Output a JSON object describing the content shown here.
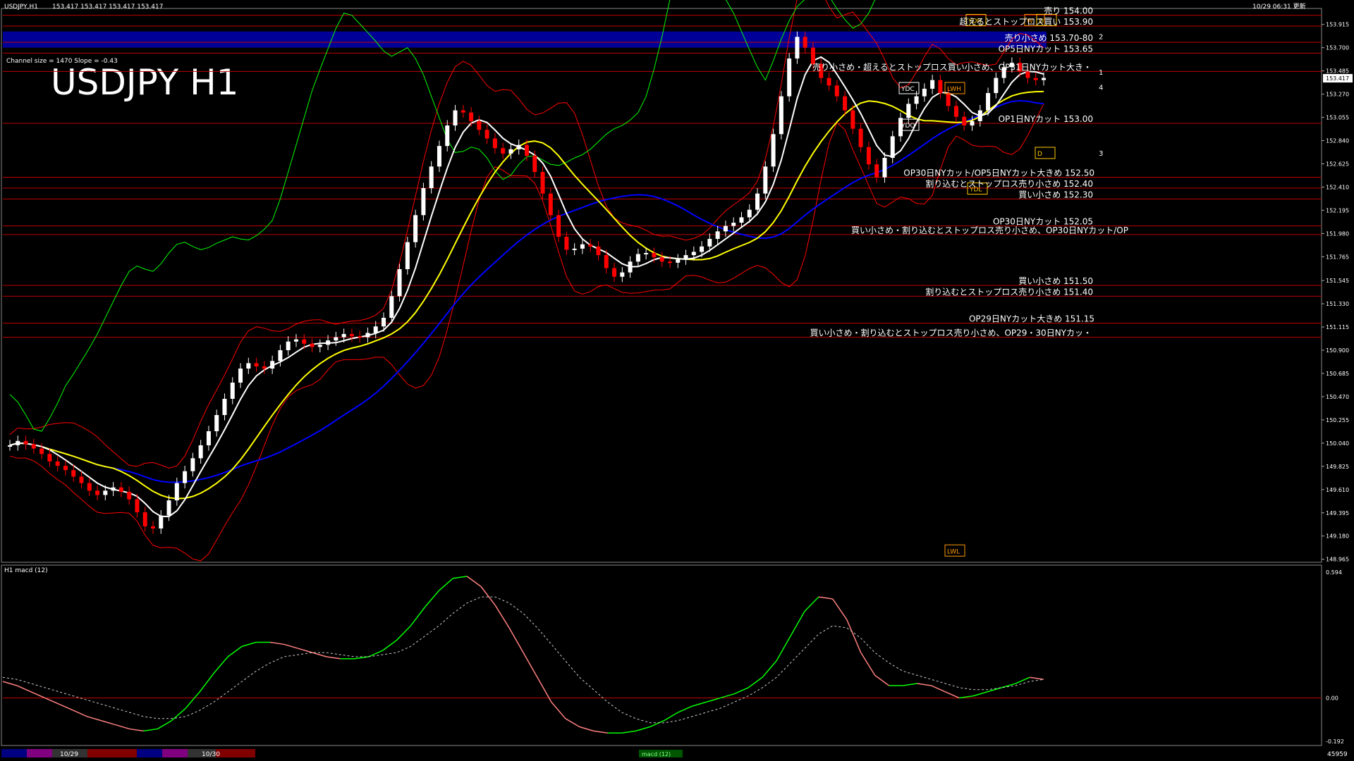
{
  "window": {
    "title": "USDJPY,H1",
    "ohlc": "153.417 153.417 153.417 153.417",
    "timestamp": "10/29 06:31 更新"
  },
  "overlay": {
    "symbol_title": "USDJPY H1",
    "channel_info": "Channel size = 1470 Slope = -0.43"
  },
  "colors": {
    "background": "#000000",
    "bull_candle": "#ffffff",
    "bear_candle": "#ff0000",
    "ma_fast": "#ffffff",
    "ma_mid": "#ffff00",
    "ma_slow": "#0000ff",
    "chikou": "#00ff00",
    "bollinger": "#ff0000",
    "macd_up": "#00ff00",
    "macd_down": "#ff8080",
    "signal": "#cccccc",
    "level_line": "#c00000",
    "zone": "#000099"
  },
  "chart_data": [
    {
      "type": "line",
      "panel": "price",
      "price_axis": {
        "ticks": [
          "153.915",
          "153.700",
          "153.485",
          "153.270",
          "153.055",
          "152.840",
          "152.625",
          "152.410",
          "152.195",
          "151.980",
          "151.765",
          "151.545",
          "151.330",
          "151.115",
          "150.900",
          "150.685",
          "150.470",
          "150.255",
          "150.040",
          "149.825",
          "149.610",
          "149.395",
          "149.180",
          "148.965"
        ],
        "ylim": [
          148.95,
          154.05
        ],
        "current_price": "153.417"
      },
      "series": [
        {
          "name": "close",
          "values": [
            150.02,
            150.06,
            150.03,
            149.99,
            149.94,
            149.87,
            149.83,
            149.79,
            149.73,
            149.67,
            149.6,
            149.56,
            149.6,
            149.63,
            149.59,
            149.52,
            149.4,
            149.27,
            149.25,
            149.37,
            149.51,
            149.67,
            149.78,
            149.9,
            150.02,
            150.15,
            150.3,
            150.45,
            150.6,
            150.73,
            150.78,
            150.75,
            150.73,
            150.8,
            150.9,
            150.98,
            151.0,
            150.96,
            150.93,
            150.95,
            150.99,
            151.02,
            151.05,
            151.03,
            151.02,
            151.06,
            151.12,
            151.2,
            151.4,
            151.65,
            151.9,
            152.15,
            152.4,
            152.6,
            152.79,
            152.98,
            153.12,
            153.1,
            153.02,
            152.94,
            152.86,
            152.77,
            152.72,
            152.76,
            152.8,
            152.7,
            152.55,
            152.35,
            152.15,
            151.95,
            151.83,
            151.84,
            151.88,
            151.86,
            151.78,
            151.66,
            151.58,
            151.62,
            151.72,
            151.79,
            151.8,
            151.76,
            151.72,
            151.71,
            151.74,
            151.78,
            151.81,
            151.86,
            151.93,
            152.0,
            152.05,
            152.08,
            152.13,
            152.2,
            152.35,
            152.6,
            152.9,
            153.25,
            153.6,
            153.8,
            153.7,
            153.55,
            153.42,
            153.35,
            153.25,
            153.12,
            152.95,
            152.78,
            152.62,
            152.5,
            152.68,
            152.88,
            153.05,
            153.18,
            153.25,
            153.32,
            153.4,
            153.28,
            153.16,
            153.06,
            152.98,
            153.02,
            153.12,
            153.28,
            153.42,
            153.52,
            153.56,
            153.48,
            153.42,
            153.4,
            153.42
          ]
        }
      ],
      "levels": [
        {
          "label": "売り 154.00",
          "price": 154.0
        },
        {
          "label": "超えるとストップロス買い 153.90",
          "price": 153.9
        },
        {
          "label": "売り小さめ 153.70-80",
          "price": 153.75
        },
        {
          "label": "OP5日NYカット 153.65",
          "price": 153.65
        },
        {
          "label": "売り小さめ・超えるとストップロス買い小さめ、OP31日NYカット大き・",
          "price": 153.48
        },
        {
          "label": "OP1日NYカット 153.00",
          "price": 153.0
        },
        {
          "label": "OP30日NYカット/OP5日NYカット大きめ 152.50",
          "price": 152.5
        },
        {
          "label": "割り込むとストップロス売り小さめ 152.40",
          "price": 152.4
        },
        {
          "label": "買い小さめ 152.30",
          "price": 152.3
        },
        {
          "label": "OP30日NYカット 152.05",
          "price": 152.05
        },
        {
          "label": "買い小さめ・割り込むとストップロス売り小さめ、OP30日NYカット/OP",
          "price": 151.97
        },
        {
          "label": "買い小さめ 151.50",
          "price": 151.5
        },
        {
          "label": "割り込むとストップロス売り小さめ 151.40",
          "price": 151.4
        },
        {
          "label": "OP29日NYカット大きめ 151.15",
          "price": 151.15
        },
        {
          "label": "買い小さめ・割り込むとストップロス売り小さめ、OP29・30日NYカッ・",
          "price": 151.02
        }
      ],
      "markers": {
        "ydh": "YDH",
        "ydc": "YDC",
        "ydo": "YDO",
        "ydl": "YDL",
        "lwh": "LWH",
        "lwl": "LWL",
        "w": "W",
        "d": "D",
        "channel_lines": [
          "1",
          "2",
          "3",
          "4"
        ]
      }
    },
    {
      "type": "line",
      "panel": "macd",
      "title": "H1 macd (12)",
      "axis": {
        "top": "0.594",
        "zero": "0.00",
        "bottom": "-0.192",
        "ylim": [
          -0.21,
          0.61
        ]
      },
      "series": [
        {
          "name": "macd",
          "values": [
            0.08,
            0.06,
            0.03,
            0.0,
            -0.03,
            -0.06,
            -0.09,
            -0.11,
            -0.13,
            -0.15,
            -0.16,
            -0.15,
            -0.11,
            -0.05,
            0.03,
            0.12,
            0.2,
            0.25,
            0.27,
            0.27,
            0.26,
            0.24,
            0.22,
            0.2,
            0.19,
            0.19,
            0.2,
            0.23,
            0.28,
            0.35,
            0.44,
            0.52,
            0.58,
            0.59,
            0.54,
            0.45,
            0.34,
            0.22,
            0.1,
            -0.02,
            -0.1,
            -0.14,
            -0.16,
            -0.17,
            -0.17,
            -0.16,
            -0.14,
            -0.11,
            -0.07,
            -0.04,
            -0.02,
            0.0,
            0.02,
            0.05,
            0.1,
            0.18,
            0.3,
            0.42,
            0.49,
            0.48,
            0.38,
            0.22,
            0.11,
            0.06,
            0.06,
            0.07,
            0.06,
            0.03,
            0.0,
            0.01,
            0.03,
            0.05,
            0.07,
            0.1,
            0.09
          ]
        },
        {
          "name": "signal",
          "values": [
            0.1,
            0.09,
            0.07,
            0.05,
            0.03,
            0.01,
            -0.01,
            -0.03,
            -0.05,
            -0.07,
            -0.09,
            -0.1,
            -0.1,
            -0.09,
            -0.06,
            -0.02,
            0.03,
            0.08,
            0.13,
            0.17,
            0.2,
            0.21,
            0.22,
            0.22,
            0.21,
            0.2,
            0.2,
            0.21,
            0.22,
            0.25,
            0.3,
            0.35,
            0.41,
            0.46,
            0.49,
            0.49,
            0.46,
            0.41,
            0.34,
            0.26,
            0.18,
            0.1,
            0.04,
            -0.02,
            -0.07,
            -0.1,
            -0.12,
            -0.12,
            -0.11,
            -0.09,
            -0.07,
            -0.05,
            -0.02,
            0.01,
            0.05,
            0.1,
            0.17,
            0.24,
            0.31,
            0.35,
            0.34,
            0.29,
            0.22,
            0.17,
            0.13,
            0.11,
            0.09,
            0.07,
            0.05,
            0.04,
            0.04,
            0.05,
            0.06,
            0.08,
            0.09
          ]
        }
      ]
    }
  ],
  "footer": {
    "date_1": "10/29",
    "date_2": "10/30",
    "center_label": "macd (12)",
    "right_number": "45959"
  }
}
